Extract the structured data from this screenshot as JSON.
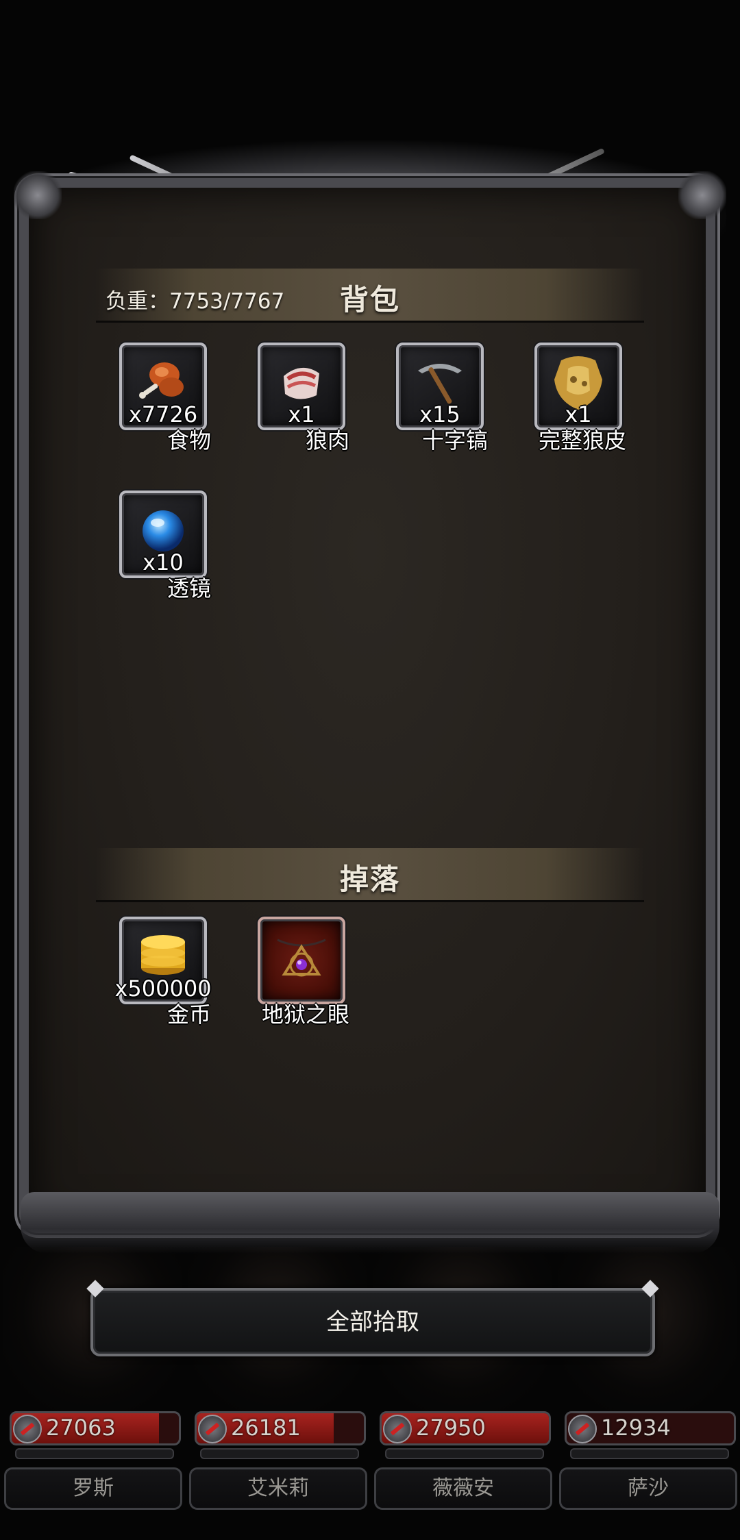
{
  "bag": {
    "title": "背包",
    "weight_label": "负重：7753/7767",
    "items": [
      {
        "name": "食物",
        "qty": "x7726",
        "icon": "food-drumstick-icon"
      },
      {
        "name": "狼肉",
        "qty": "x1",
        "icon": "wolf-meat-icon"
      },
      {
        "name": "十字镐",
        "qty": "x15",
        "icon": "pickaxe-icon"
      },
      {
        "name": "完整狼皮",
        "qty": "x1",
        "icon": "wolf-pelt-icon"
      },
      {
        "name": "透镜",
        "qty": "x10",
        "icon": "blue-lens-orb-icon"
      }
    ]
  },
  "drop": {
    "title": "掉落",
    "items": [
      {
        "name": "金币",
        "qty": "x500000",
        "icon": "gold-coins-icon"
      },
      {
        "name": "地狱之眼",
        "qty": "",
        "icon": "hell-eye-amulet-icon"
      }
    ]
  },
  "pick_all_label": "全部拾取",
  "heroes": [
    {
      "name": "罗斯",
      "hp": "27063",
      "hp_fraction": 0.88
    },
    {
      "name": "艾米莉",
      "hp": "26181",
      "hp_fraction": 0.82
    },
    {
      "name": "薇薇安",
      "hp": "27950",
      "hp_fraction": 1.0
    },
    {
      "name": "萨沙",
      "hp": "12934",
      "hp_fraction": 0.0
    }
  ],
  "colors": {
    "hp_red": "#a8231f",
    "panel_bg": "#231f1b",
    "frame_metal": "#6b6b70"
  }
}
